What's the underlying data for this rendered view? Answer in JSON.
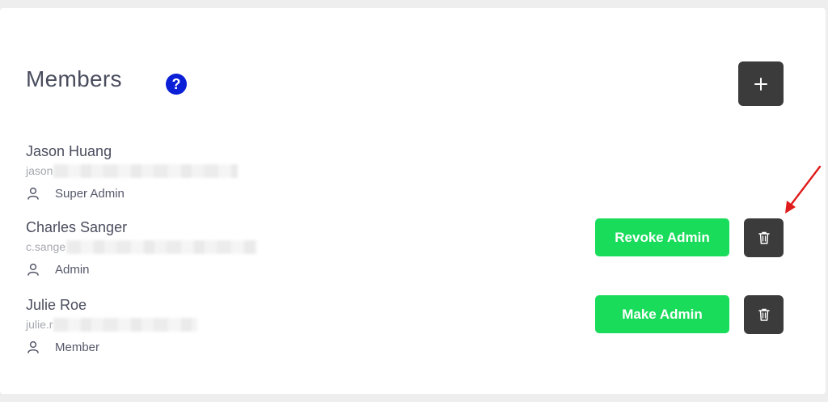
{
  "header": {
    "title": "Members"
  },
  "members": [
    {
      "name": "Jason Huang",
      "email_visible": "jason",
      "role": "Super Admin"
    },
    {
      "name": "Charles Sanger",
      "email_visible": "c.sange",
      "role": "Admin",
      "action_label": "Revoke Admin"
    },
    {
      "name": "Julie Roe",
      "email_visible": "julie.r",
      "role": "Member",
      "action_label": "Make Admin"
    }
  ],
  "colors": {
    "action_green": "#19dc5b",
    "dark_button": "#3b3b3b",
    "help_blue": "#0a1fd6",
    "annotation_red": "#e01b1b"
  },
  "icons": [
    "help-icon",
    "plus-icon",
    "user-icon",
    "trash-icon",
    "annotation-arrow"
  ]
}
